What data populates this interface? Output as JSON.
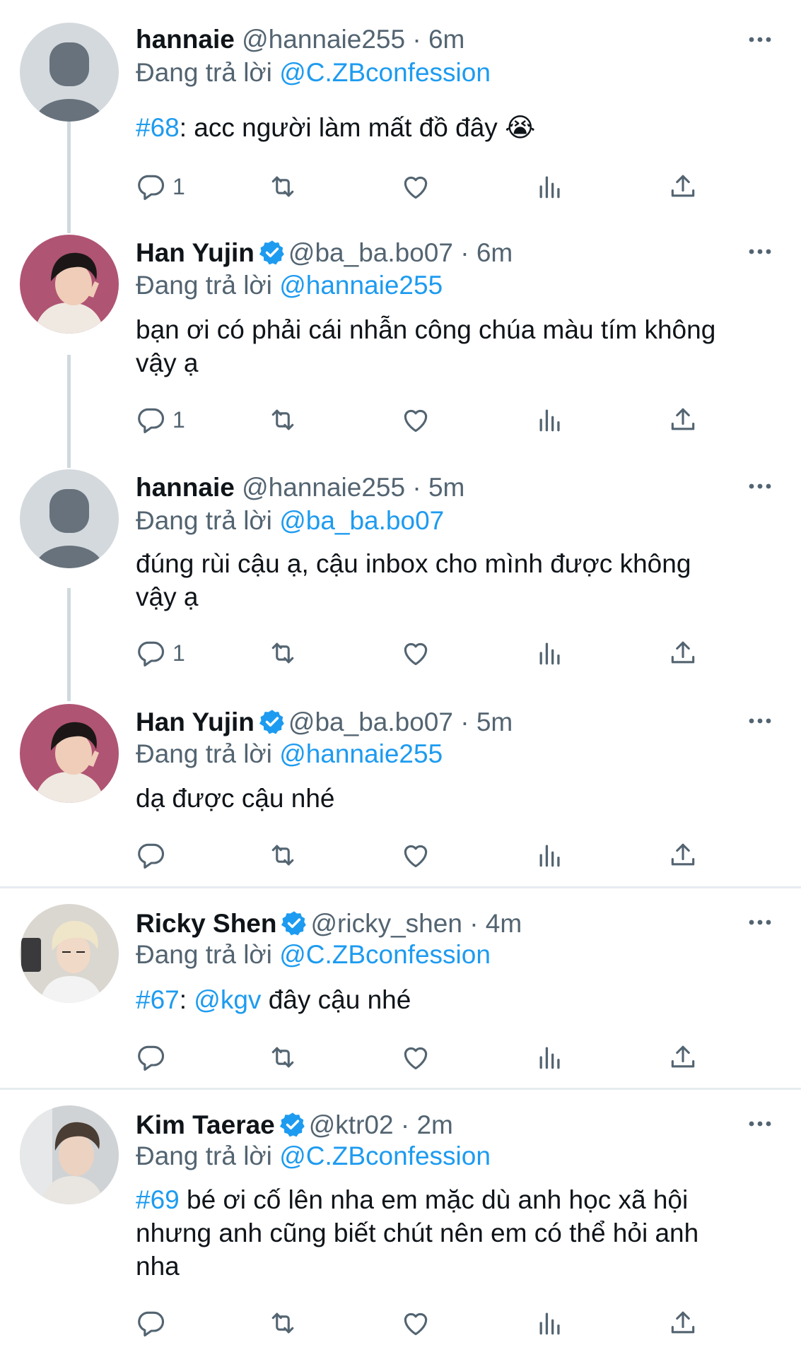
{
  "reply_prefix": "Đang trả lời",
  "tweets": [
    {
      "name": "hannaie",
      "handle": "@hannaie255",
      "sep": "·",
      "time": "6m",
      "reply_to": "@C.ZBconfession",
      "body_tag": "#68",
      "body_text": ": acc người làm mất đồ đây 😭",
      "reply_count": "1"
    },
    {
      "name": "Han Yujin",
      "handle": "@ba_ba.bo07",
      "sep": "·",
      "time": "6m",
      "reply_to": "@hannaie255",
      "body_line1": "bạn ơi có phải cái nhẫn công chúa màu tím không",
      "body_line2": "vậy ạ",
      "reply_count": "1"
    },
    {
      "name": "hannaie",
      "handle": "@hannaie255",
      "sep": "·",
      "time": "5m",
      "reply_to": "@ba_ba.bo07",
      "body_line1": "đúng rùi cậu ạ, cậu inbox cho mình được không",
      "body_line2": "vậy ạ",
      "reply_count": "1"
    },
    {
      "name": "Han Yujin",
      "handle": "@ba_ba.bo07",
      "sep": "·",
      "time": "5m",
      "reply_to": "@hannaie255",
      "body_text": "dạ được cậu nhé",
      "reply_count": ""
    },
    {
      "name": "Ricky Shen",
      "handle": "@ricky_shen",
      "sep": "·",
      "time": "4m",
      "reply_to": "@C.ZBconfession",
      "body_tag": "#67",
      "body_colon": ": ",
      "body_mention": "@kgv",
      "body_text": " đây cậu nhé",
      "reply_count": ""
    },
    {
      "name": "Kim Taerae",
      "handle": "@ktr02",
      "sep": "·",
      "time": "2m",
      "reply_to": "@C.ZBconfession",
      "body_tag": "#69",
      "body_line1": " bé ơi cố lên nha em mặc dù anh học xã hội",
      "body_line2": "nhưng anh cũng biết chút nên em có thể hỏi anh",
      "body_line3": "nha",
      "reply_count": ""
    }
  ],
  "icons": [
    "reply-icon",
    "retweet-icon",
    "like-icon",
    "views-icon",
    "share-icon",
    "more-icon",
    "verified-icon"
  ],
  "colors": {
    "link": "#1d9bf0",
    "muted": "#536471",
    "thread_line": "#cfd9de",
    "verified": "#1d9bf0"
  }
}
